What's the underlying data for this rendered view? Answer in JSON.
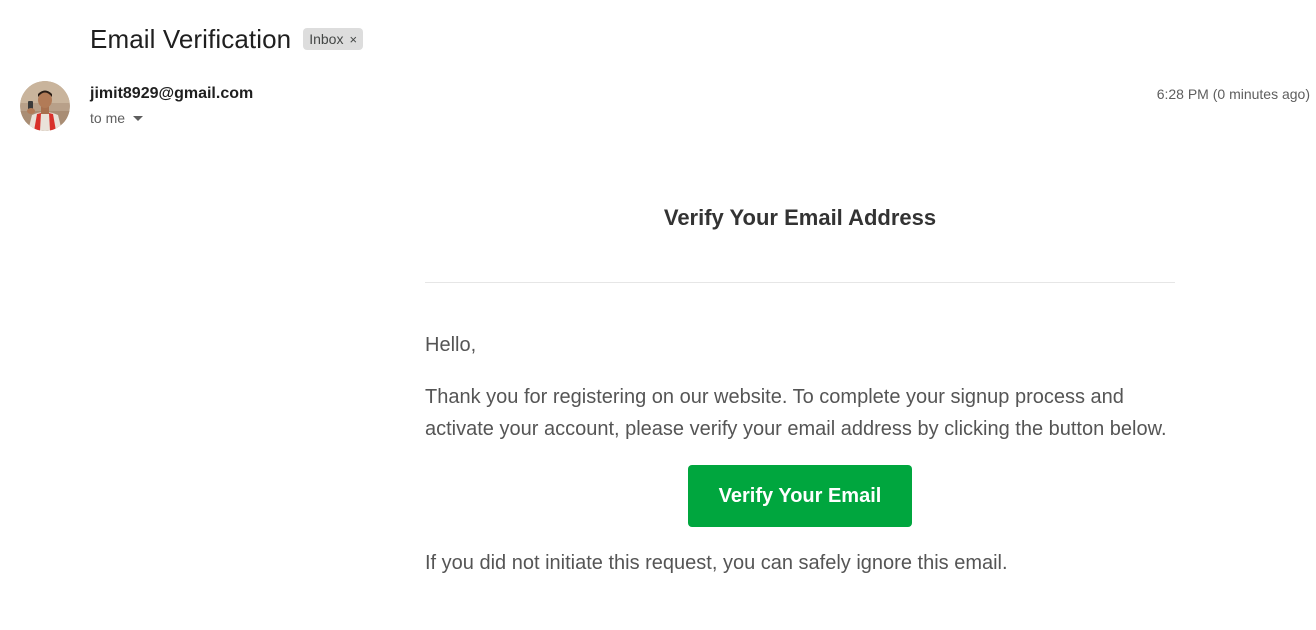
{
  "subject": {
    "title": "Email Verification",
    "label": "Inbox",
    "label_close": "×"
  },
  "sender": {
    "email": "jimit8929@gmail.com",
    "recipient_line": "to me",
    "timestamp": "6:28 PM (0 minutes ago)"
  },
  "message": {
    "heading": "Verify Your Email Address",
    "greeting": "Hello,",
    "intro": "Thank you for registering on our website. To complete your signup process and activate your account, please verify your email address by clicking the button below.",
    "button_label": "Verify Your Email",
    "footer": "If you did not initiate this request, you can safely ignore this email."
  },
  "colors": {
    "button": "#00a63e",
    "heading": "#333333",
    "body_text": "#555555"
  },
  "icons": {
    "avatar": "sender-avatar",
    "recipient_dropdown": "caret-down-icon",
    "label_remove": "close-icon"
  }
}
